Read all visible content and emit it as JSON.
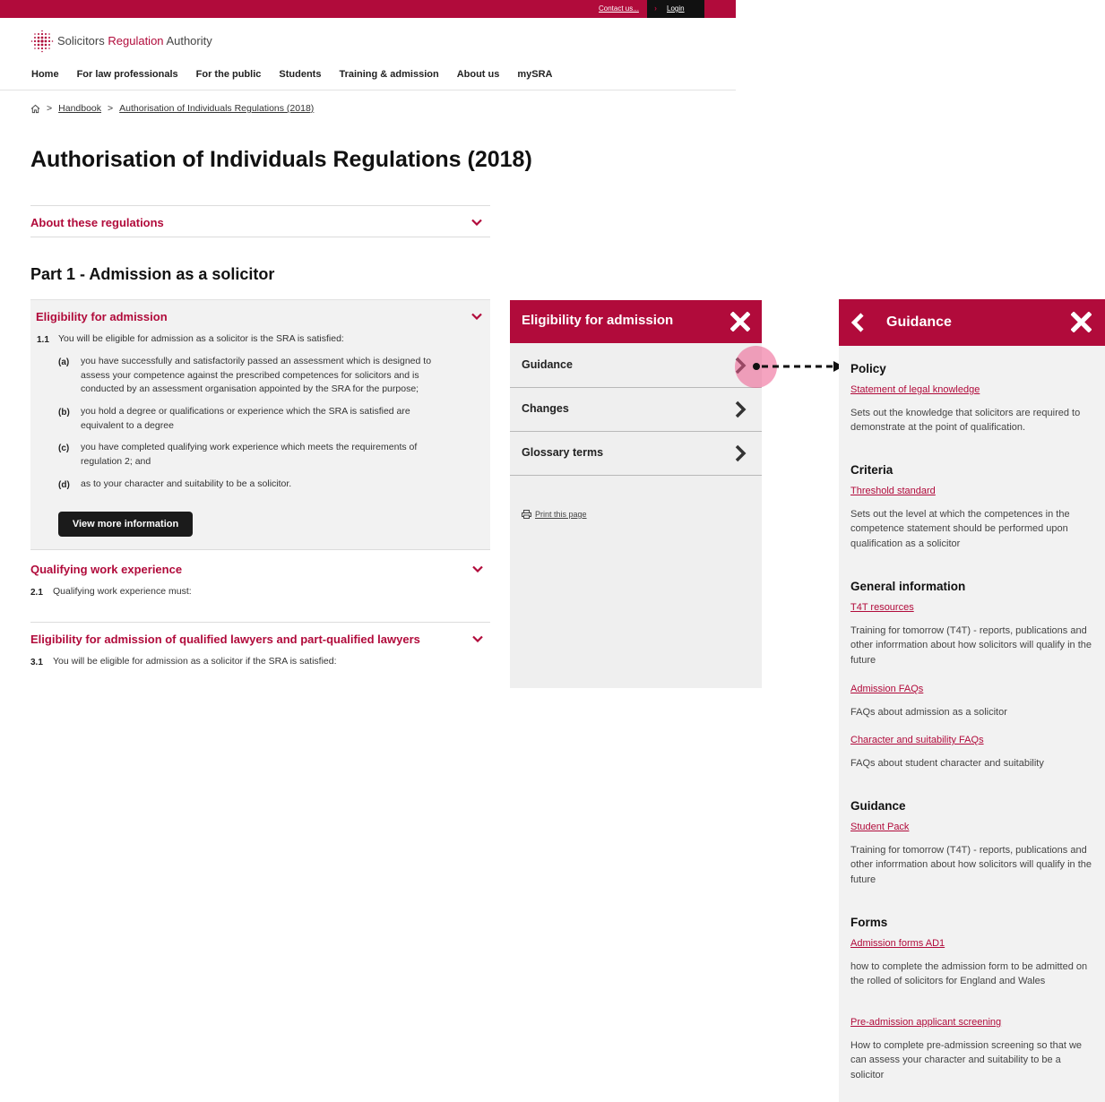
{
  "topbar": {
    "contact_label": "Contact us...",
    "login_label": "Login"
  },
  "logo": {
    "word1": "Solicitors",
    "word2": "Regulation",
    "word3": "Authority"
  },
  "nav": [
    "Home",
    "For law professionals",
    "For the public",
    "Students",
    "Training & admission",
    "About us",
    "mySRA"
  ],
  "breadcrumb": {
    "sep": ">",
    "items": [
      "Handbook",
      "Authorisation of Individuals Regulations (2018)"
    ]
  },
  "page_title": "Authorisation of Individuals Regulations (2018)",
  "about_section": {
    "title": "About these regulations"
  },
  "part1_heading": "Part 1 - Admission as a solicitor",
  "eligibility": {
    "title": "Eligibility for admission",
    "clause_num": "1.1",
    "clause_text": "You will be eligible for admission as a solicitor is the SRA is satisfied:",
    "items": [
      {
        "label": "(a)",
        "text": "you have successfully and satisfactorily passed an assessment which is designed to assess your competence against the prescribed competences for solicitors and is conducted by an assessment organisation appointed by the SRA for the purpose;"
      },
      {
        "label": "(b)",
        "text": "you hold a degree or qualifications or experience which the SRA is satisfied are equivalent to a degree"
      },
      {
        "label": "(c)",
        "text": "you have completed qualifying work experience which meets the requirements of regulation 2; and"
      },
      {
        "label": "(d)",
        "text": "as to your character and suitability to be a solicitor."
      }
    ],
    "button": "View more information"
  },
  "qualifying": {
    "title": "Qualifying work experience",
    "clause_num": "2.1",
    "clause_text": "Qualifying work experience must:"
  },
  "lawyers": {
    "title": "Eligibility for admission of qualified lawyers and part-qualified lawyers",
    "clause_num": "3.1",
    "clause_text": "You will be eligible for admission as a solicitor if the SRA is satisfied:"
  },
  "mid_panel": {
    "title": "Eligibility for admission",
    "rows": [
      "Guidance",
      "Changes",
      "Glossary terms"
    ],
    "print_label": "Print this page"
  },
  "guide_panel": {
    "title": "Guidance",
    "sections": [
      {
        "heading": "Policy",
        "link": "Statement of legal knowledge",
        "desc": "Sets out the knowledge that solicitors are required to demonstrate at the point of qualification."
      },
      {
        "heading": "Criteria",
        "link": "Threshold standard",
        "desc": "Sets out the level at which the competences in the competence statement should be performed upon qualification as a solicitor"
      },
      {
        "heading": "General information",
        "link": "T4T resources",
        "desc": "Training for tomorrow (T4T) - reports, publications and other inforrmation about how solicitors will qualify in the future"
      },
      {
        "link": "Admission FAQs",
        "desc": "FAQs about admission as a solicitor"
      },
      {
        "link": "Character and suitability FAQs",
        "desc": "FAQs about student character and suitability"
      },
      {
        "heading": "Guidance",
        "link": "Student Pack",
        "desc": "Training for tomorrow (T4T) - reports, publications and other inforrmation about how solicitors will qualify in the future"
      },
      {
        "heading": "Forms",
        "link": "Admission forms AD1",
        "desc": "how to complete the admission form to be admitted on the rolled of solicitors for England and Wales"
      },
      {
        "link": "Pre-admission applicant screening",
        "desc": "How to complete pre-admission screening so that we can assess your character and suitability to be a solicitor"
      }
    ]
  },
  "colors": {
    "brand": "#b10b3b",
    "panel_bg": "#f2f2f2",
    "dark_button": "#1b1b1b",
    "tap_marker": "#ec5a8c"
  }
}
